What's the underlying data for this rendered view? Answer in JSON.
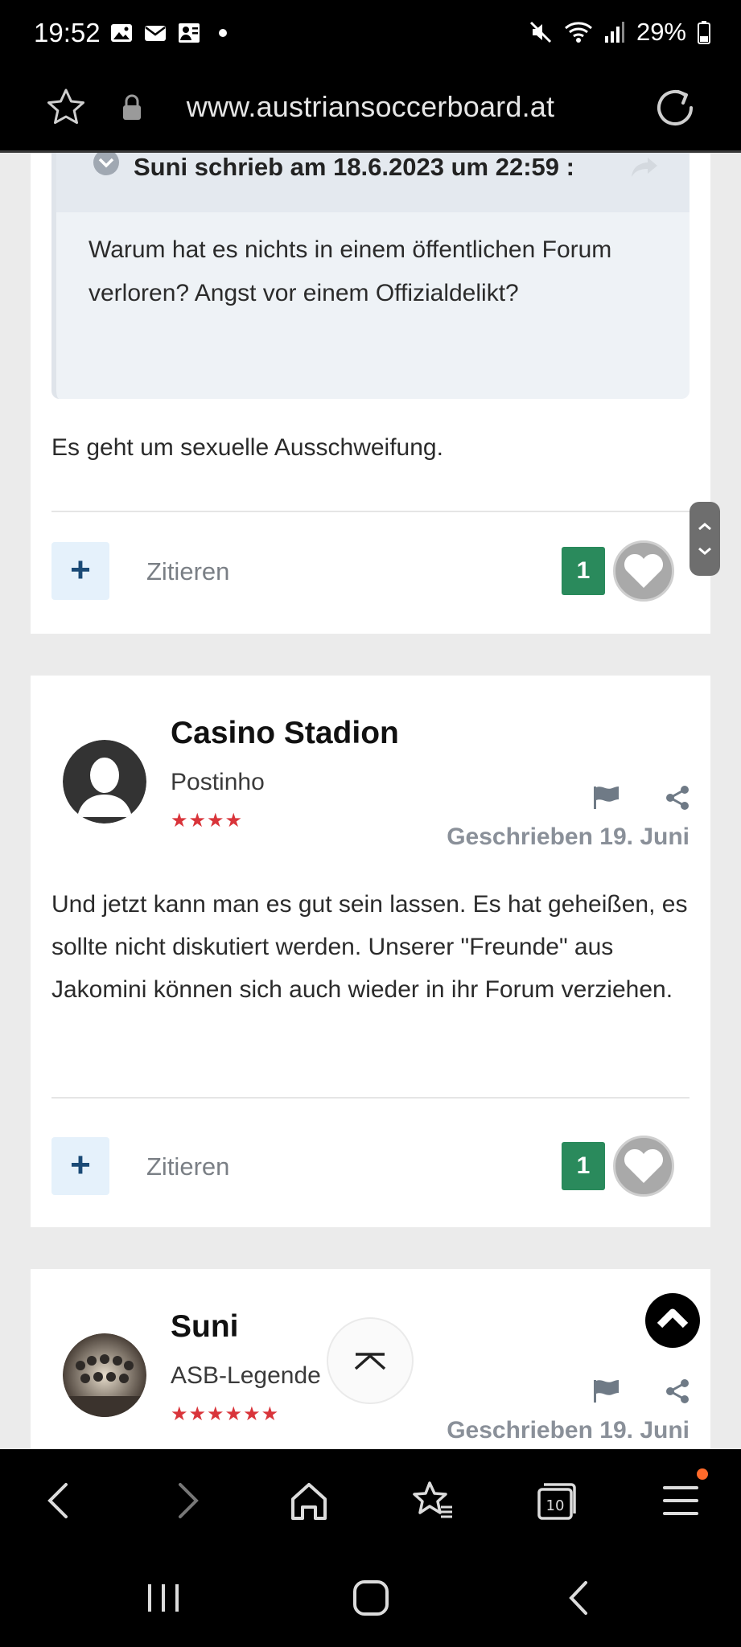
{
  "status": {
    "time": "19:52",
    "battery": "29%"
  },
  "browser": {
    "url": "www.austriansoccerboard.at"
  },
  "posts": [
    {
      "quote": {
        "header": "Suni schrieb am 18.6.2023 um 22:59 :",
        "body": "Warum hat es nichts in einem öffentlichen Forum verloren? Angst vor einem Offizialdelikt?"
      },
      "text": "Es geht um sexuelle Ausschweifung.",
      "plus_label": "+",
      "cite_label": "Zitieren",
      "likes": "1"
    },
    {
      "author": "Casino Stadion",
      "rank": "Postinho",
      "stars": "★★★★",
      "date": "Geschrieben 19. Juni",
      "text": "Und jetzt kann man es gut sein lassen. Es hat geheißen, es sollte nicht diskutiert werden. Unserer \"Freunde\" aus Jakomini können sich auch wieder in ihr Forum verziehen.",
      "plus_label": "+",
      "cite_label": "Zitieren",
      "likes": "1"
    },
    {
      "author": "Suni",
      "rank": "ASB-Legende",
      "stars": "★★★★★★",
      "date": "Geschrieben 19. Juni"
    }
  ],
  "colors": {
    "like_green": "#2a8a5c",
    "star_red": "#d9343a",
    "notification_dot": "#ff6a2a"
  }
}
